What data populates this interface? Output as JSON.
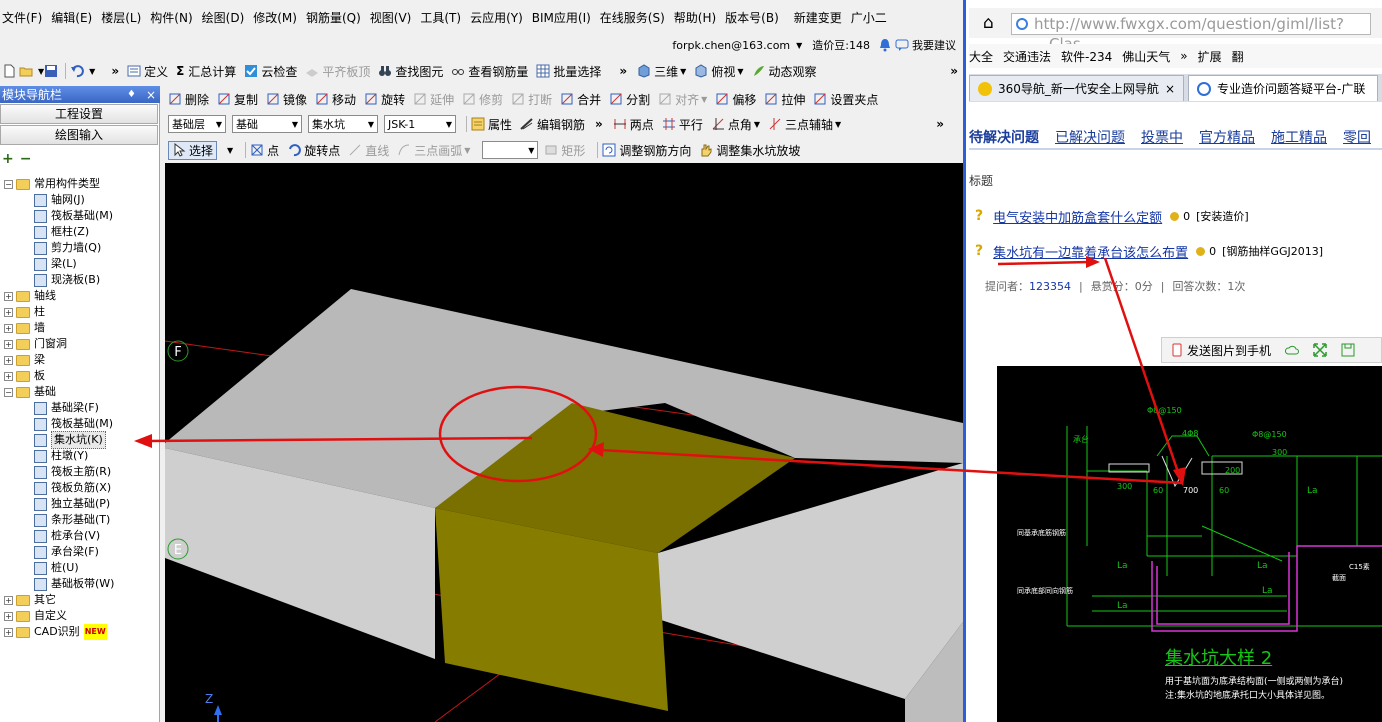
{
  "app": {
    "menu": [
      "文件(F)",
      "编辑(E)",
      "楼层(L)",
      "构件(N)",
      "绘图(D)",
      "修改(M)",
      "钢筋量(Q)",
      "视图(V)",
      "工具(T)",
      "云应用(Y)",
      "BIM应用(I)",
      "在线服务(S)",
      "帮助(H)",
      "版本号(B)",
      "新建变更",
      "广小二"
    ],
    "account": {
      "email": "forpk.chen@163.com",
      "beans": "造价豆:148",
      "suggest": "我要建议"
    },
    "toolbar1": [
      "定义",
      "汇总计算",
      "云检查",
      "平齐板顶",
      "查找图元",
      "查看钢筋量",
      "批量选择",
      "三维",
      "俯视",
      "动态观察"
    ],
    "nav": {
      "title": "模块导航栏",
      "pin": "♦",
      "close": "×",
      "btn_settings": "工程设置",
      "btn_drawing": "绘图输入",
      "tools": [
        "+",
        "−"
      ],
      "tree": [
        {
          "label": "常用构件类型",
          "level": 0,
          "type": "folder",
          "expanded": true
        },
        {
          "label": "轴网(J)",
          "level": 1,
          "type": "item"
        },
        {
          "label": "筏板基础(M)",
          "level": 1,
          "type": "item"
        },
        {
          "label": "框柱(Z)",
          "level": 1,
          "type": "item"
        },
        {
          "label": "剪力墙(Q)",
          "level": 1,
          "type": "item"
        },
        {
          "label": "梁(L)",
          "level": 1,
          "type": "item"
        },
        {
          "label": "现浇板(B)",
          "level": 1,
          "type": "item"
        },
        {
          "label": "轴线",
          "level": 0,
          "type": "folder",
          "expanded": false
        },
        {
          "label": "柱",
          "level": 0,
          "type": "folder",
          "expanded": false
        },
        {
          "label": "墙",
          "level": 0,
          "type": "folder",
          "expanded": false
        },
        {
          "label": "门窗洞",
          "level": 0,
          "type": "folder",
          "expanded": false
        },
        {
          "label": "梁",
          "level": 0,
          "type": "folder",
          "expanded": false
        },
        {
          "label": "板",
          "level": 0,
          "type": "folder",
          "expanded": false
        },
        {
          "label": "基础",
          "level": 0,
          "type": "folder",
          "expanded": true
        },
        {
          "label": "基础梁(F)",
          "level": 1,
          "type": "item"
        },
        {
          "label": "筏板基础(M)",
          "level": 1,
          "type": "item"
        },
        {
          "label": "集水坑(K)",
          "level": 1,
          "type": "item",
          "selected": true
        },
        {
          "label": "柱墩(Y)",
          "level": 1,
          "type": "item"
        },
        {
          "label": "筏板主筋(R)",
          "level": 1,
          "type": "item"
        },
        {
          "label": "筏板负筋(X)",
          "level": 1,
          "type": "item"
        },
        {
          "label": "独立基础(P)",
          "level": 1,
          "type": "item"
        },
        {
          "label": "条形基础(T)",
          "level": 1,
          "type": "item"
        },
        {
          "label": "桩承台(V)",
          "level": 1,
          "type": "item"
        },
        {
          "label": "承台梁(F)",
          "level": 1,
          "type": "item"
        },
        {
          "label": "桩(U)",
          "level": 1,
          "type": "item"
        },
        {
          "label": "基础板带(W)",
          "level": 1,
          "type": "item"
        },
        {
          "label": "其它",
          "level": 0,
          "type": "folder",
          "expanded": false
        },
        {
          "label": "自定义",
          "level": 0,
          "type": "folder",
          "expanded": false
        },
        {
          "label": "CAD识别",
          "level": 0,
          "type": "folder",
          "expanded": false,
          "badge": "NEW"
        }
      ]
    },
    "toolbar2": [
      "删除",
      "复制",
      "镜像",
      "移动",
      "旋转",
      "延伸",
      "修剪",
      "打断",
      "合并",
      "分割",
      "对齐",
      "偏移",
      "拉伸",
      "设置夹点"
    ],
    "toolbar3": {
      "floor": "基础层",
      "category": "基础",
      "type": "集水坑",
      "name": "JSK-1",
      "props": "属性",
      "edit_rebar": "编辑钢筋",
      "two_points": "两点",
      "parallel": "平行",
      "point_angle": "点角",
      "three_point_axis": "三点辅轴"
    },
    "toolbar4": {
      "select": "选择",
      "point": "点",
      "rotate_point": "旋转点",
      "line": "直线",
      "arc": "三点画弧",
      "rect": "矩形",
      "adjust_rebar": "调整钢筋方向",
      "adjust_slope": "调整集水坑放坡"
    },
    "viewport": {
      "axis_f": "F",
      "axis_e": "E",
      "axis_z": "Z"
    }
  },
  "browser": {
    "url": "http://www.fwxgx.com/question/giml/list?__Clas",
    "bookmarks": [
      "大全",
      "交通违法",
      "软件-234",
      "佛山天气",
      "»",
      "扩展",
      "翻"
    ],
    "tabs": [
      {
        "label": "360导航_新一代安全上网导航",
        "close": "×"
      },
      {
        "label": "专业造价问题答疑平台-广联"
      }
    ],
    "qnav": [
      "待解决问题",
      "已解决问题",
      "投票中",
      "官方精品",
      "施工精品",
      "零回"
    ],
    "header": "标题",
    "questions": [
      {
        "title": "电气安装中加筋盒套什么定额",
        "score": "0",
        "tag": "[安装造价]"
      },
      {
        "title": "集水坑有一边靠着承台该怎么布置",
        "score": "0",
        "tag": "[钢筋抽样GGJ2013]"
      }
    ],
    "meta": {
      "asker_label": "提问者：",
      "asker": "123354",
      "reward": "悬赏分：0分",
      "answers": "回答次数：1次"
    },
    "send": "发送图片到手机",
    "cad": {
      "labels": [
        "Φ8@150",
        "4Φ8",
        "Φ8@150",
        "300",
        "承台",
        "300",
        "60",
        "700",
        "60",
        "200",
        "La",
        "La",
        "La",
        "La",
        "La",
        "同基承底筋钢筋",
        "同承底部同向钢筋",
        "C15素",
        "截面"
      ],
      "title": "集水坑大样  2",
      "note1": "用于基坑面为底承结构面(一侧或两侧为承台)",
      "note2": "注:集水坑的地底承托口大小具体详见图。"
    }
  },
  "colors": {
    "accent": "#2b5fd8",
    "arrow": "#e01010",
    "pit": "#7a7000",
    "slab": "#b9b9b9",
    "cad_line": "#16c616"
  }
}
